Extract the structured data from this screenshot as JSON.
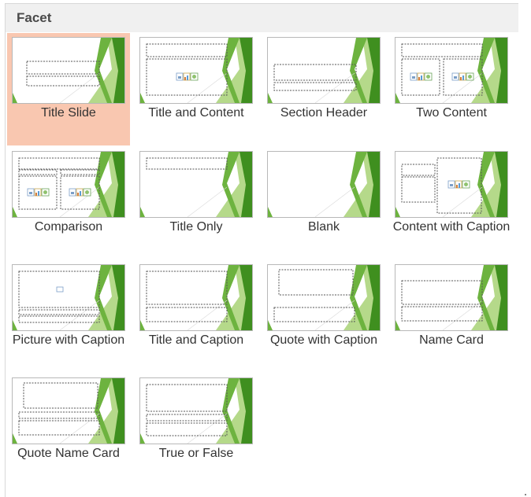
{
  "panel": {
    "title": "Facet"
  },
  "layouts": [
    {
      "label": "Title Slide",
      "kind": "title-slide",
      "selected": true
    },
    {
      "label": "Title and Content",
      "kind": "title-content",
      "selected": false
    },
    {
      "label": "Section Header",
      "kind": "section-header",
      "selected": false
    },
    {
      "label": "Two Content",
      "kind": "two-content",
      "selected": false
    },
    {
      "label": "Comparison",
      "kind": "comparison",
      "selected": false
    },
    {
      "label": "Title Only",
      "kind": "title-only",
      "selected": false
    },
    {
      "label": "Blank",
      "kind": "blank",
      "selected": false
    },
    {
      "label": "Content with Caption",
      "kind": "content-caption",
      "selected": false
    },
    {
      "label": "Picture with Caption",
      "kind": "picture-caption",
      "selected": false
    },
    {
      "label": "Title and Caption",
      "kind": "title-caption",
      "selected": false
    },
    {
      "label": "Quote with Caption",
      "kind": "quote-caption",
      "selected": false
    },
    {
      "label": "Name Card",
      "kind": "name-card",
      "selected": false
    },
    {
      "label": "Quote Name Card",
      "kind": "quote-name-card",
      "selected": false
    },
    {
      "label": "True or False",
      "kind": "true-false",
      "selected": false
    }
  ],
  "colors": {
    "selected_bg": "#f9c7b0",
    "green_dark": "#3f8f1f",
    "green_mid": "#6db33f",
    "green_light": "#b5d98a"
  }
}
